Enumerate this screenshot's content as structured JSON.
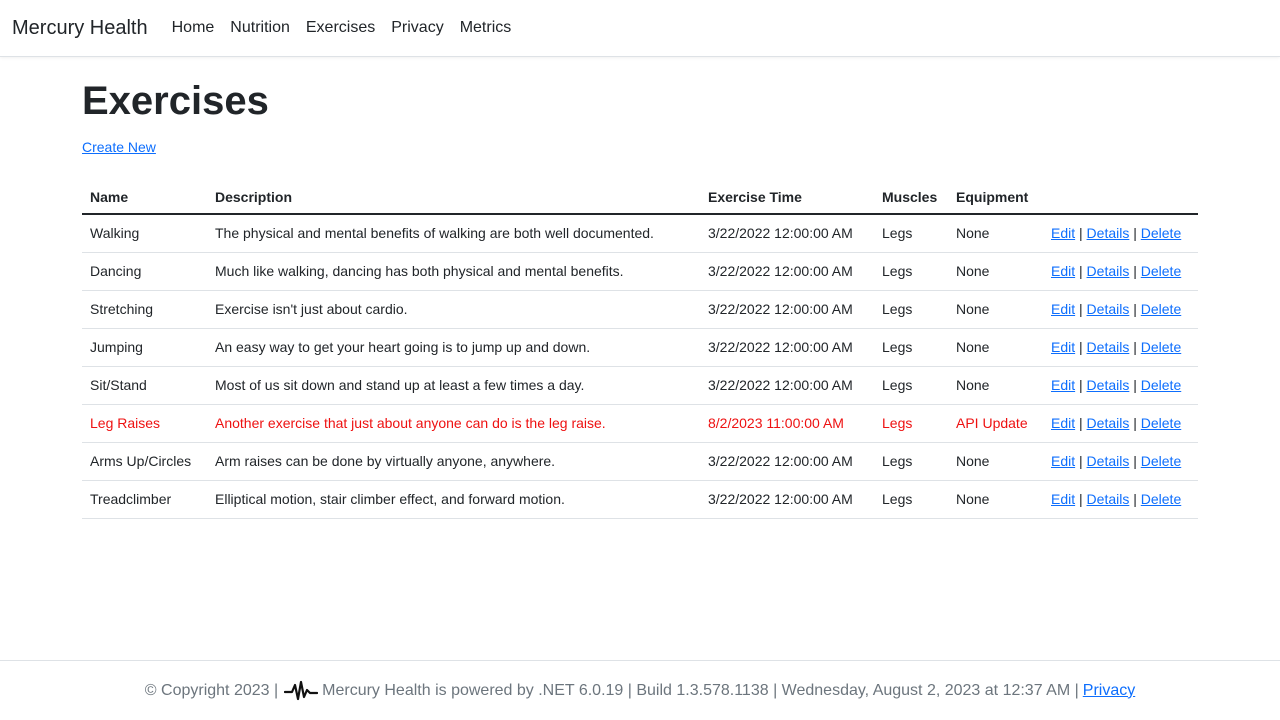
{
  "navbar": {
    "brand": "Mercury Health",
    "links": [
      "Home",
      "Nutrition",
      "Exercises",
      "Privacy",
      "Metrics"
    ]
  },
  "main": {
    "title": "Exercises",
    "create_link": "Create New",
    "columns": [
      "Name",
      "Description",
      "Exercise Time",
      "Muscles",
      "Equipment"
    ],
    "action_labels": {
      "edit": "Edit",
      "details": "Details",
      "delete": "Delete",
      "separator": "|"
    },
    "rows": [
      {
        "name": "Walking",
        "description": "The physical and mental benefits of walking are both well documented.",
        "time": "3/22/2022 12:00:00 AM",
        "muscles": "Legs",
        "equipment": "None",
        "highlight": false
      },
      {
        "name": "Dancing",
        "description": "Much like walking, dancing has both physical and mental benefits.",
        "time": "3/22/2022 12:00:00 AM",
        "muscles": "Legs",
        "equipment": "None",
        "highlight": false
      },
      {
        "name": "Stretching",
        "description": "Exercise isn't just about cardio.",
        "time": "3/22/2022 12:00:00 AM",
        "muscles": "Legs",
        "equipment": "None",
        "highlight": false
      },
      {
        "name": "Jumping",
        "description": "An easy way to get your heart going is to jump up and down.",
        "time": "3/22/2022 12:00:00 AM",
        "muscles": "Legs",
        "equipment": "None",
        "highlight": false
      },
      {
        "name": "Sit/Stand",
        "description": "Most of us sit down and stand up at least a few times a day.",
        "time": "3/22/2022 12:00:00 AM",
        "muscles": "Legs",
        "equipment": "None",
        "highlight": false
      },
      {
        "name": "Leg Raises",
        "description": "Another exercise that just about anyone can do is the leg raise.",
        "time": "8/2/2023 11:00:00 AM",
        "muscles": "Legs",
        "equipment": "API Update",
        "highlight": true
      },
      {
        "name": "Arms Up/Circles",
        "description": "Arm raises can be done by virtually anyone, anywhere.",
        "time": "3/22/2022 12:00:00 AM",
        "muscles": "Legs",
        "equipment": "None",
        "highlight": false
      },
      {
        "name": "Treadclimber",
        "description": "Elliptical motion, stair climber effect, and forward motion.",
        "time": "3/22/2022 12:00:00 AM",
        "muscles": "Legs",
        "equipment": "None",
        "highlight": false
      }
    ]
  },
  "footer": {
    "copyright": "© Copyright 2023 |",
    "icon": "heartbeat-pulse-icon",
    "text": "Mercury Health is powered by .NET 6.0.19 | Build 1.3.578.1138 | Wednesday, August 2, 2023 at 12:37 AM |",
    "privacy_link": "Privacy"
  },
  "colors": {
    "link": "#0d6efd",
    "highlight_row": "#ee1111",
    "text": "#212529",
    "muted": "#6c757d"
  }
}
